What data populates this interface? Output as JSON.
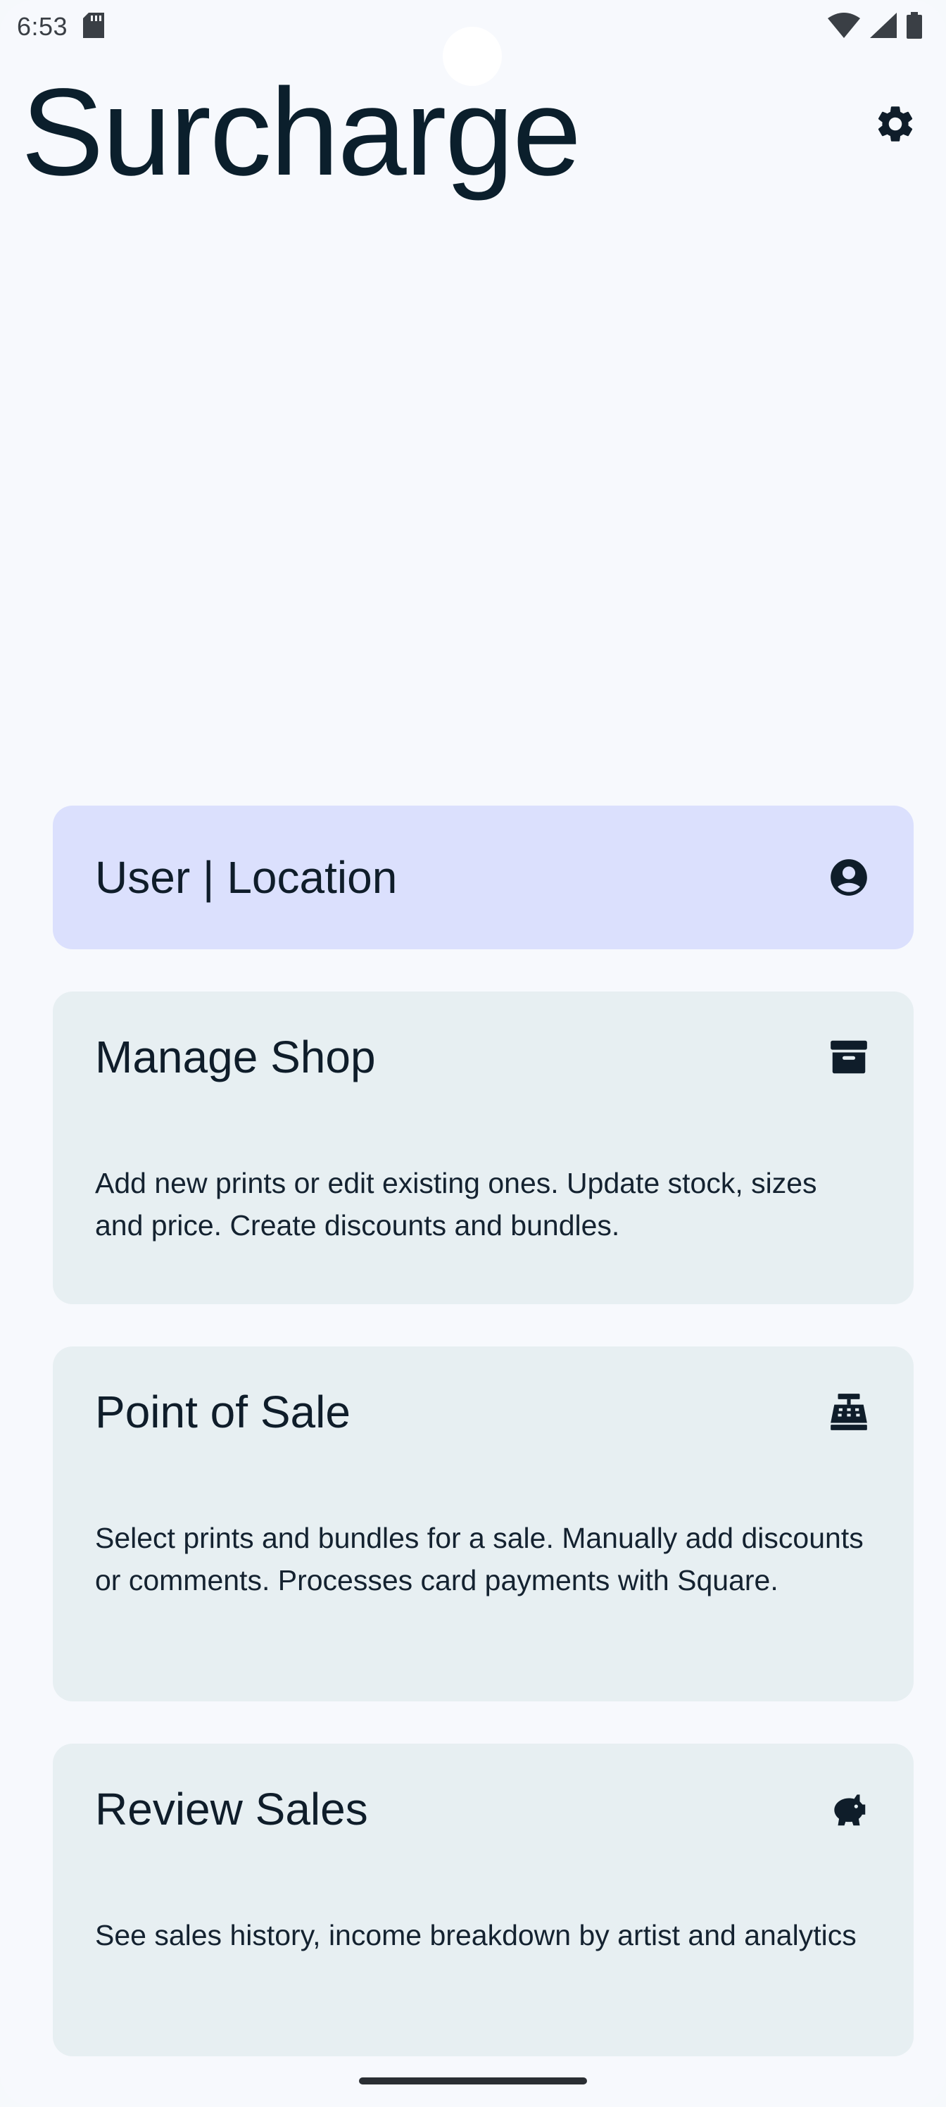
{
  "status_bar": {
    "time": "6:53"
  },
  "header": {
    "title": "Surcharge",
    "settings_icon": "gear-icon"
  },
  "cards": [
    {
      "id": "user-location",
      "title": "User | Location",
      "icon": "account-circle-icon",
      "description": ""
    },
    {
      "id": "manage-shop",
      "title": "Manage Shop",
      "icon": "archive-box-icon",
      "description": "Add new prints or edit existing ones. Update stock, sizes and price. Create discounts and bundles."
    },
    {
      "id": "point-of-sale",
      "title": "Point of Sale",
      "icon": "cash-register-icon",
      "description": "Select prints and bundles for a sale. Manually add discounts or comments. Processes card payments with Square."
    },
    {
      "id": "review-sales",
      "title": "Review Sales",
      "icon": "piggy-bank-icon",
      "description": "See sales history, income breakdown by artist and analytics"
    }
  ],
  "colors": {
    "background": "#f7f9fd",
    "primary_card": "#dbe0fd",
    "secondary_card": "#e7eff2",
    "text": "#0f1d2a"
  }
}
